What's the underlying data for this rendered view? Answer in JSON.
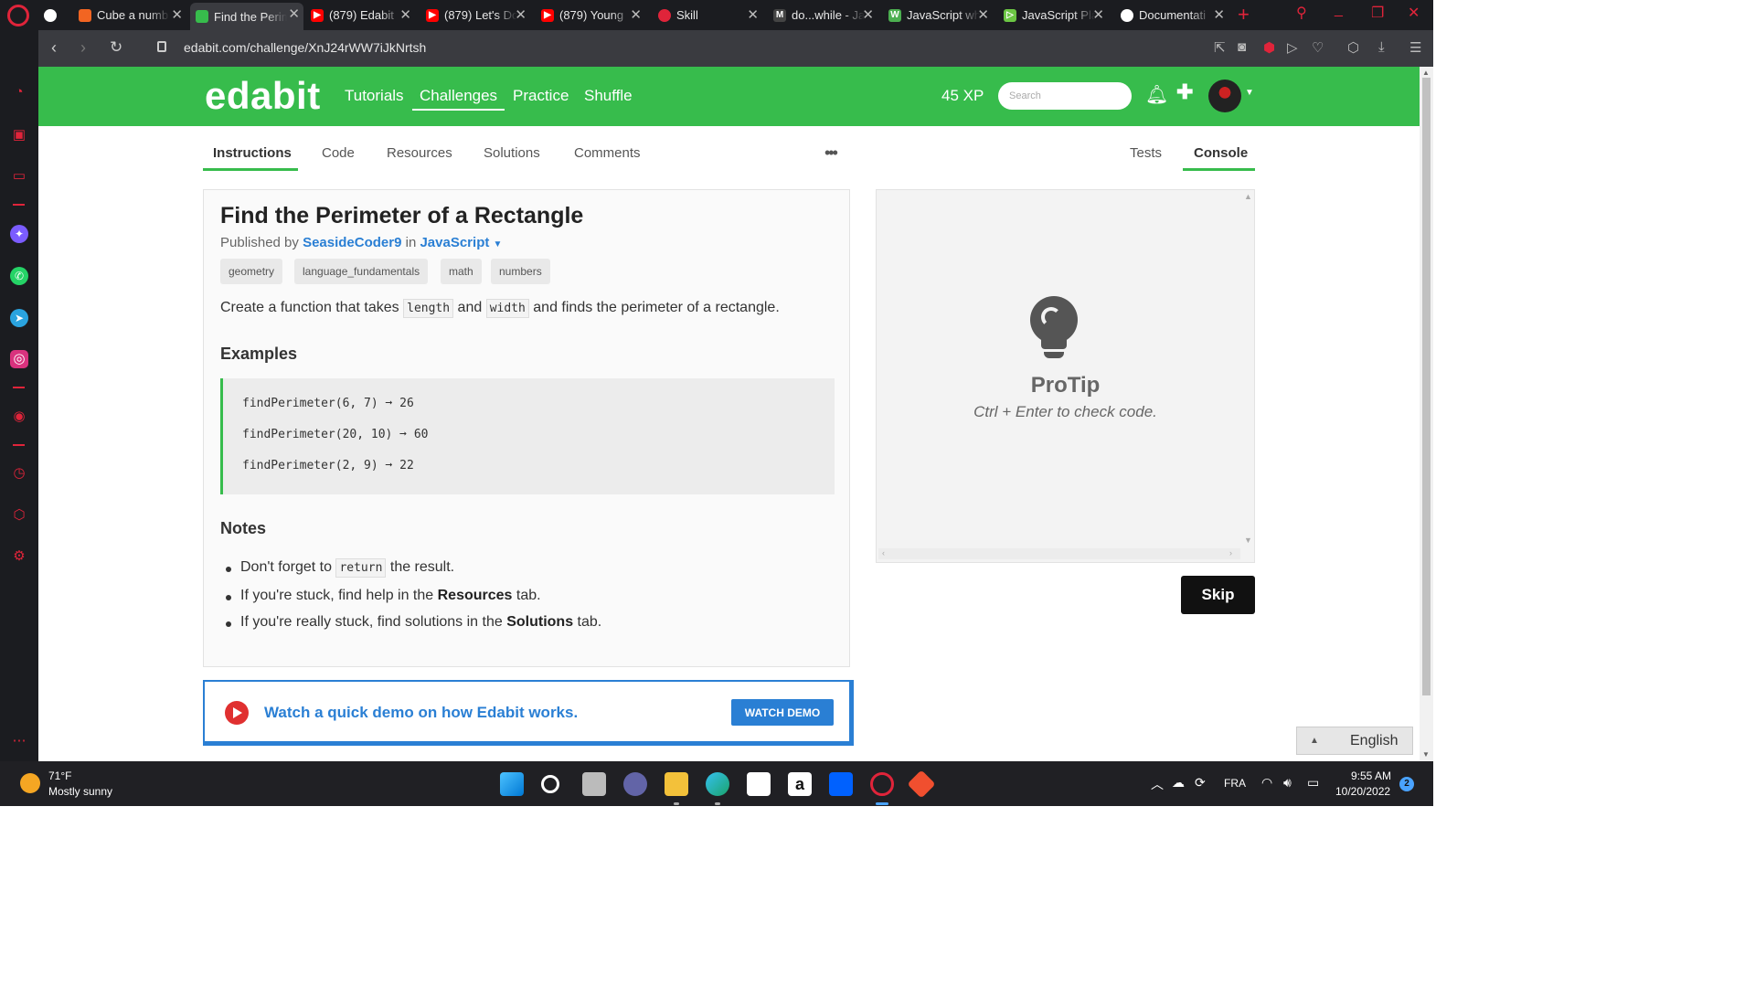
{
  "browser": {
    "tabs": [
      {
        "title": "Cube a numb",
        "color": "#f26522"
      },
      {
        "title": "Find the Perim",
        "color": "#37bc4c"
      },
      {
        "title": "(879) Edabit",
        "color": "#ff0000"
      },
      {
        "title": "(879) Let's Do",
        "color": "#ff0000"
      },
      {
        "title": "(879) Young",
        "color": "#ff0000"
      },
      {
        "title": "Skill",
        "color": "#e0243a"
      },
      {
        "title": "do...while - Ja",
        "color": "#444444"
      },
      {
        "title": "JavaScript wh",
        "color": "#4caf50"
      },
      {
        "title": "JavaScript Pla",
        "color": "#6cc644"
      },
      {
        "title": "Documentati",
        "color": "#ffffff"
      }
    ],
    "url": "edabit.com/challenge/XnJ24rWW7iJkNrtsh"
  },
  "header": {
    "logo": "edabit",
    "nav": [
      "Tutorials",
      "Challenges",
      "Practice",
      "Shuffle"
    ],
    "xp": "45 XP",
    "search_placeholder": "Search"
  },
  "tabs": {
    "left": [
      "Instructions",
      "Code",
      "Resources",
      "Solutions",
      "Comments"
    ],
    "more": "•••",
    "right": [
      "Tests",
      "Console"
    ]
  },
  "challenge": {
    "title": "Find the Perimeter of a Rectangle",
    "published_by_prefix": "Published by ",
    "author": "SeasideCoder9",
    "in_text": " in ",
    "language": "JavaScript",
    "tags": [
      "geometry",
      "language_fundamentals",
      "math",
      "numbers"
    ],
    "description": {
      "part1": "Create a function that takes ",
      "code1": "length",
      "part2": " and ",
      "code2": "width",
      "part3": " and finds the perimeter of a rectangle."
    },
    "examples_heading": "Examples",
    "examples": [
      "findPerimeter(6, 7) ➞ 26",
      "findPerimeter(20, 10) ➞ 60",
      "findPerimeter(2, 9) ➞ 22"
    ],
    "notes_heading": "Notes",
    "notes": {
      "n1_pre": "Don't forget to ",
      "n1_code": "return",
      "n1_post": " the result.",
      "n2_pre": "If you're stuck, find help in the ",
      "n2_bold": "Resources",
      "n2_post": " tab.",
      "n3_pre": "If you're really stuck, find solutions in the ",
      "n3_bold": "Solutions",
      "n3_post": " tab."
    }
  },
  "demo": {
    "text": "Watch a quick demo on how Edabit works.",
    "button": "WATCH DEMO"
  },
  "console": {
    "protip_title": "ProTip",
    "protip_text": "Ctrl + Enter to check code."
  },
  "skip_button": "Skip",
  "language_selector": "English",
  "taskbar": {
    "temp": "71°F",
    "weather": "Mostly sunny",
    "lang": "FRA",
    "time": "9:55 AM",
    "date": "10/20/2022",
    "notifications": "2"
  },
  "colors": {
    "brand_green": "#37bc4c",
    "link_blue": "#2a7fd4",
    "opera_red": "#e0243a"
  }
}
